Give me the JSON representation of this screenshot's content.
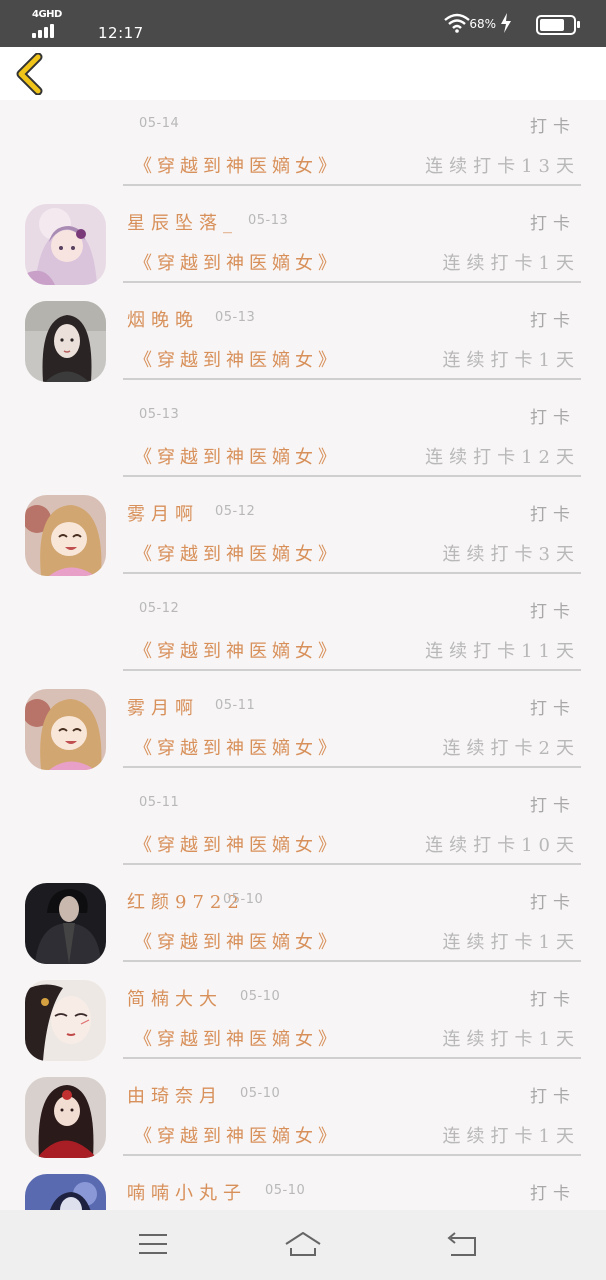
{
  "status_bar": {
    "network": "4GHD",
    "time": "12:17",
    "battery_percent": "68%"
  },
  "header": {
    "back_icon": "chevron-left-icon",
    "accent_color": "#f0c419"
  },
  "list": [
    {
      "name": "",
      "date": "05-14",
      "action": "打卡",
      "book": "《穿越到神医嫡女》",
      "streak": "连续打卡13天",
      "avatar": null
    },
    {
      "name": "星辰坠落_",
      "date": "05-13",
      "action": "打卡",
      "book": "《穿越到神医嫡女》",
      "streak": "连续打卡1天",
      "avatar": "anime-girl-pink"
    },
    {
      "name": "烟晚晚",
      "date": "05-13",
      "action": "打卡",
      "book": "《穿越到神医嫡女》",
      "streak": "连续打卡1天",
      "avatar": "dark-haired-girl"
    },
    {
      "name": "",
      "date": "05-13",
      "action": "打卡",
      "book": "《穿越到神医嫡女》",
      "streak": "连续打卡12天",
      "avatar": null
    },
    {
      "name": "雾月啊",
      "date": "05-12",
      "action": "打卡",
      "book": "《穿越到神医嫡女》",
      "streak": "连续打卡3天",
      "avatar": "laughing-girl"
    },
    {
      "name": "",
      "date": "05-12",
      "action": "打卡",
      "book": "《穿越到神医嫡女》",
      "streak": "连续打卡11天",
      "avatar": null
    },
    {
      "name": "雾月啊",
      "date": "05-11",
      "action": "打卡",
      "book": "《穿越到神医嫡女》",
      "streak": "连续打卡2天",
      "avatar": "laughing-girl"
    },
    {
      "name": "",
      "date": "05-11",
      "action": "打卡",
      "book": "《穿越到神医嫡女》",
      "streak": "连续打卡10天",
      "avatar": null
    },
    {
      "name": "红颜9722",
      "date": "05-10",
      "action": "打卡",
      "book": "《穿越到神医嫡女》",
      "streak": "连续打卡1天",
      "avatar": "dark-figure"
    },
    {
      "name": "简楠大大",
      "date": "05-10",
      "action": "打卡",
      "book": "《穿越到神医嫡女》",
      "streak": "连续打卡1天",
      "avatar": "painted-lady"
    },
    {
      "name": "由琦奈月",
      "date": "05-10",
      "action": "打卡",
      "book": "《穿越到神医嫡女》",
      "streak": "连续打卡1天",
      "avatar": "red-dress-lady"
    },
    {
      "name": "喃喃小丸子",
      "date": "05-10",
      "action": "打卡",
      "book": "",
      "streak": "",
      "avatar": "blue-night-girl"
    }
  ],
  "nav_bar": {
    "menu_icon": "menu-icon",
    "home_icon": "home-icon",
    "back_icon": "return-icon"
  }
}
